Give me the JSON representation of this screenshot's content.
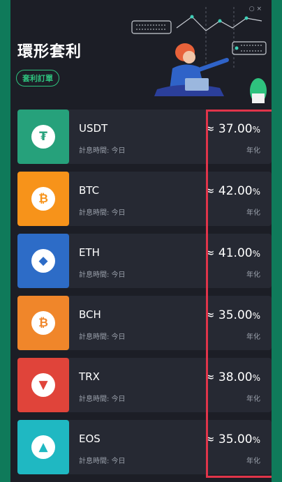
{
  "page": {
    "title": "環形套利",
    "orders_button": "套利訂單",
    "window_controls": "○ ×"
  },
  "rows": [
    {
      "coin": "USDT",
      "interest_label": "計息時間: 今日",
      "rate": "≈ 37.00",
      "rate_unit": "%",
      "annual_label": "年化",
      "tile_color": "#26a17b",
      "icon": "tether-icon",
      "glyph": "₮",
      "glyph_color": "#26a17b"
    },
    {
      "coin": "BTC",
      "interest_label": "計息時間: 今日",
      "rate": "≈ 42.00",
      "rate_unit": "%",
      "annual_label": "年化",
      "tile_color": "#f7931a",
      "icon": "bitcoin-icon",
      "glyph": "₿",
      "glyph_color": "#f7931a"
    },
    {
      "coin": "ETH",
      "interest_label": "計息時間: 今日",
      "rate": "≈ 41.00",
      "rate_unit": "%",
      "annual_label": "年化",
      "tile_color": "#2d6cc7",
      "icon": "ethereum-icon",
      "glyph": "◆",
      "glyph_color": "#2d6cc7"
    },
    {
      "coin": "BCH",
      "interest_label": "計息時間: 今日",
      "rate": "≈ 35.00",
      "rate_unit": "%",
      "annual_label": "年化",
      "tile_color": "#f0862a",
      "icon": "bitcoin-cash-icon",
      "glyph": "₿",
      "glyph_color": "#f0862a"
    },
    {
      "coin": "TRX",
      "interest_label": "計息時間: 今日",
      "rate": "≈ 38.00",
      "rate_unit": "%",
      "annual_label": "年化",
      "tile_color": "#e0443a",
      "icon": "tron-icon",
      "glyph": "▼",
      "glyph_color": "#e0443a"
    },
    {
      "coin": "EOS",
      "interest_label": "計息時間: 今日",
      "rate": "≈ 35.00",
      "rate_unit": "%",
      "annual_label": "年化",
      "tile_color": "#1fb8c2",
      "icon": "eos-icon",
      "glyph": "▲",
      "glyph_color": "#1fb8c2"
    }
  ],
  "colors": {
    "background": "#1c1e26",
    "row": "#262933",
    "accent": "#2ec27e",
    "highlight_border": "#e0344a"
  }
}
